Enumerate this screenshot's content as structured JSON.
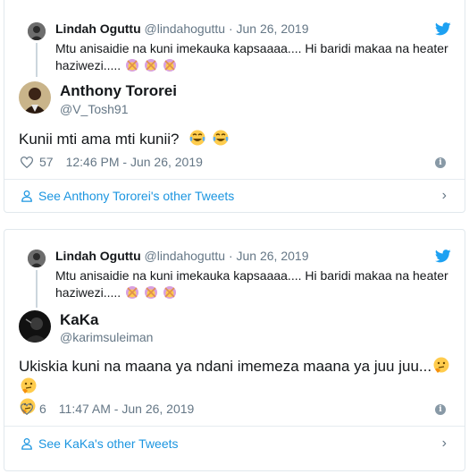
{
  "colors": {
    "accent": "#1da1f2",
    "link": "#1b95e0",
    "muted": "#657786",
    "border": "#e1e8ed"
  },
  "tweets": [
    {
      "quoted": {
        "name": "Lindah Oguttu",
        "handle": "@lindahoguttu",
        "separator": "·",
        "date": "Jun 26, 2019",
        "text": "Mtu anisaidie na kuni imekauka kapsaaaa.... Hi baridi makaa na heater haziwezi.....",
        "emojis": [
          "woman-gesturing-no",
          "woman-gesturing-no",
          "woman-gesturing-no"
        ]
      },
      "author": {
        "name": "Anthony Tororei",
        "handle": "@V_Tosh91"
      },
      "text": "Kunii mti ama mti kunii?",
      "text_emojis": [
        "tears-of-joy",
        "tears-of-joy"
      ],
      "likes": "57",
      "timestamp": "12:46 PM - Jun 26, 2019",
      "other_tweets_label": "See Anthony Tororei's other Tweets"
    },
    {
      "quoted": {
        "name": "Lindah Oguttu",
        "handle": "@lindahoguttu",
        "separator": "·",
        "date": "Jun 26, 2019",
        "text": "Mtu anisaidie na kuni imekauka kapsaaaa.... Hi baridi makaa na heater haziwezi.....",
        "emojis": [
          "woman-gesturing-no",
          "woman-gesturing-no",
          "woman-gesturing-no"
        ]
      },
      "author": {
        "name": "KaKa",
        "handle": "@karimsuleiman"
      },
      "text": "Ukiskia kuni na maana ya ndani imemeza maana ya juu juu...",
      "text_emojis": [
        "thinking-face",
        "thinking-face",
        "thinking-face"
      ],
      "likes": "6",
      "timestamp": "11:47 AM - Jun 26, 2019",
      "other_tweets_label": "See KaKa's other Tweets"
    }
  ]
}
